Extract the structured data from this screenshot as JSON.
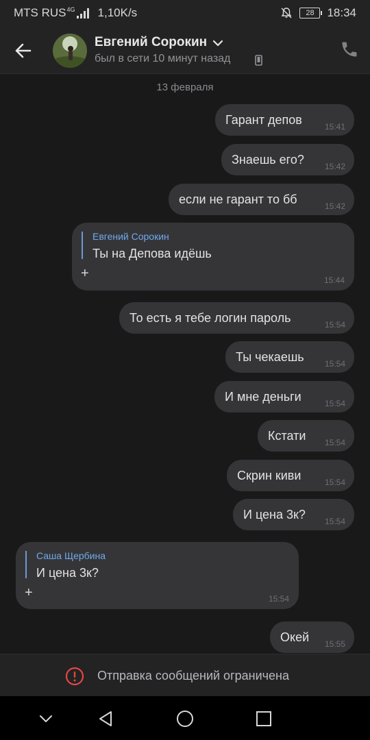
{
  "status_bar": {
    "carrier": "MTS RUS",
    "network": "4G",
    "speed": "1,10K/s",
    "battery": "28",
    "time": "18:34"
  },
  "header": {
    "contact_name": "Евгений Сорокин",
    "last_seen": "был в сети 10 минут назад"
  },
  "chat": {
    "date": "13 февраля",
    "messages": [
      {
        "text": "Гарант депов",
        "time": "15:41"
      },
      {
        "text": "Знаешь его?",
        "time": "15:42"
      },
      {
        "text": "если не гарант то бб",
        "time": "15:42"
      },
      {
        "author": "Евгений Сорокин",
        "text": "Ты на Депова идёшь",
        "plus": "+",
        "time": "15:44"
      },
      {
        "text": "То есть я тебе логин пароль",
        "time": "15:54"
      },
      {
        "text": "Ты чекаешь",
        "time": "15:54"
      },
      {
        "text": "И мне деньги",
        "time": "15:54"
      },
      {
        "text": "Кстати",
        "time": "15:54"
      },
      {
        "text": "Скрин киви",
        "time": "15:54"
      },
      {
        "text": "И цена 3к?",
        "time": "15:54"
      },
      {
        "author": "Саша Щербина",
        "text": "И цена 3к?",
        "plus": "+",
        "time": "15:54"
      },
      {
        "text": "Окей",
        "time": "15:55"
      }
    ]
  },
  "restriction": {
    "text": "Отправка сообщений ограничена"
  },
  "colors": {
    "background": "#19191a",
    "bubble": "#353538",
    "accent_blue": "#71aaeb",
    "warning_red": "#e64646"
  },
  "icons": [
    "back-arrow-icon",
    "chevron-down-icon",
    "phone-device-icon",
    "phone-call-icon",
    "warning-icon",
    "nav-down-icon",
    "nav-back-icon",
    "nav-home-icon",
    "nav-recents-icon"
  ]
}
